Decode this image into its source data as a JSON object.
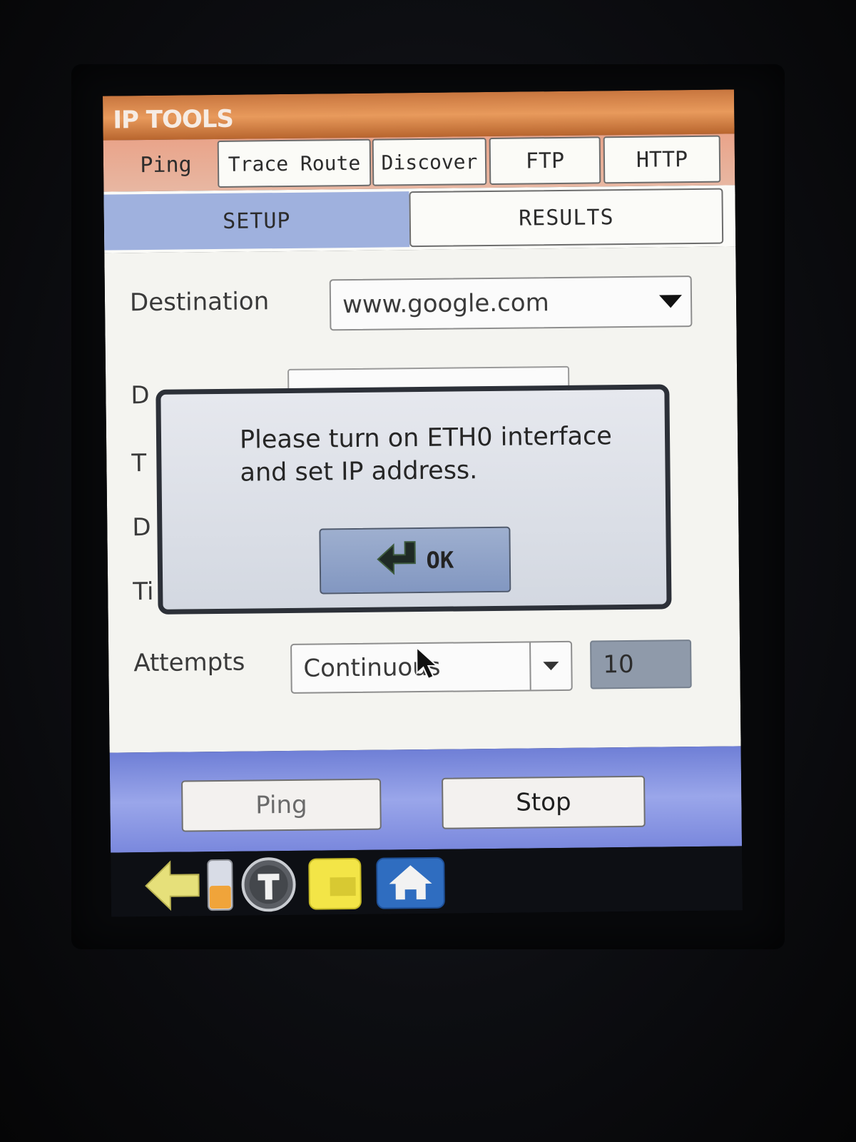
{
  "app": {
    "title": "IP TOOLS"
  },
  "tabs": [
    {
      "label": "Ping",
      "active": true
    },
    {
      "label": "Trace Route",
      "active": false
    },
    {
      "label": "Discover",
      "active": false
    },
    {
      "label": "FTP",
      "active": false
    },
    {
      "label": "HTTP",
      "active": false
    }
  ],
  "subtabs": [
    {
      "label": "SETUP",
      "active": true
    },
    {
      "label": "RESULTS",
      "active": false
    }
  ],
  "form": {
    "destination": {
      "label": "Destination",
      "value": "www.google.com"
    },
    "hidden_labels": [
      "D",
      "T",
      "D",
      "Ti"
    ],
    "attempts": {
      "label": "Attempts",
      "value": "Continuous",
      "count": "10"
    }
  },
  "dialog": {
    "message": "Please turn on ETH0 interface and set IP address.",
    "ok_label": "OK"
  },
  "footer": {
    "ping_label": "Ping",
    "stop_label": "Stop"
  },
  "taskbar": {
    "icons": [
      "back-arrow-icon",
      "battery-icon",
      "t-icon",
      "folder-icon",
      "home-icon"
    ]
  },
  "colors": {
    "title_bar": "#e0874b",
    "setup_tab": "#9fb1de",
    "footer_bar": "#8a96e2",
    "dialog_border": "#2c3038",
    "ok_button": "#8ea1c8"
  }
}
